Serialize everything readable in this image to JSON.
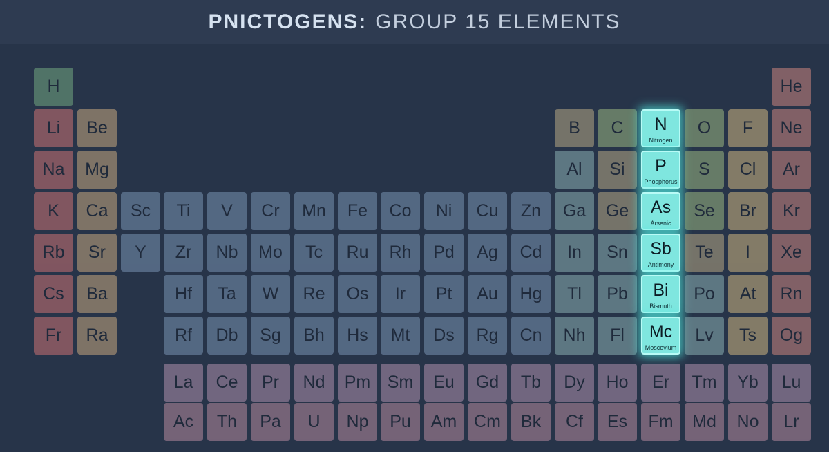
{
  "title": {
    "strong": "PNICTOGENS:",
    "light": "GROUP 15 ELEMENTS"
  },
  "colors": {
    "background": "#273449",
    "title_bar": "#2e3b51",
    "highlight": "#7fe6df",
    "highlight_glow": "#50ebe1"
  },
  "rows": [
    [
      [
        "H",
        "hydrogen"
      ],
      null,
      null,
      null,
      null,
      null,
      null,
      null,
      null,
      null,
      null,
      null,
      null,
      null,
      null,
      null,
      null,
      [
        "He",
        "noble"
      ]
    ],
    [
      [
        "Li",
        "alkali"
      ],
      [
        "Be",
        "alkaline"
      ],
      null,
      null,
      null,
      null,
      null,
      null,
      null,
      null,
      null,
      null,
      [
        "B",
        "metalloid"
      ],
      [
        "C",
        "nonmetal"
      ],
      [
        "N",
        "nonmetal",
        "Nitrogen"
      ],
      [
        "O",
        "nonmetal"
      ],
      [
        "F",
        "halogen"
      ],
      [
        "Ne",
        "noble"
      ]
    ],
    [
      [
        "Na",
        "alkali"
      ],
      [
        "Mg",
        "alkaline"
      ],
      null,
      null,
      null,
      null,
      null,
      null,
      null,
      null,
      null,
      null,
      [
        "Al",
        "post"
      ],
      [
        "Si",
        "metalloid"
      ],
      [
        "P",
        "nonmetal",
        "Phosphorus"
      ],
      [
        "S",
        "nonmetal"
      ],
      [
        "Cl",
        "halogen"
      ],
      [
        "Ar",
        "noble"
      ]
    ],
    [
      [
        "K",
        "alkali"
      ],
      [
        "Ca",
        "alkaline"
      ],
      [
        "Sc",
        "transition"
      ],
      [
        "Ti",
        "transition"
      ],
      [
        "V",
        "transition"
      ],
      [
        "Cr",
        "transition"
      ],
      [
        "Mn",
        "transition"
      ],
      [
        "Fe",
        "transition"
      ],
      [
        "Co",
        "transition"
      ],
      [
        "Ni",
        "transition"
      ],
      [
        "Cu",
        "transition"
      ],
      [
        "Zn",
        "transition"
      ],
      [
        "Ga",
        "post"
      ],
      [
        "Ge",
        "metalloid"
      ],
      [
        "As",
        "metalloid",
        "Arsenic"
      ],
      [
        "Se",
        "nonmetal"
      ],
      [
        "Br",
        "halogen"
      ],
      [
        "Kr",
        "noble"
      ]
    ],
    [
      [
        "Rb",
        "alkali"
      ],
      [
        "Sr",
        "alkaline"
      ],
      [
        "Y",
        "transition"
      ],
      [
        "Zr",
        "transition"
      ],
      [
        "Nb",
        "transition"
      ],
      [
        "Mo",
        "transition"
      ],
      [
        "Tc",
        "transition"
      ],
      [
        "Ru",
        "transition"
      ],
      [
        "Rh",
        "transition"
      ],
      [
        "Pd",
        "transition"
      ],
      [
        "Ag",
        "transition"
      ],
      [
        "Cd",
        "transition"
      ],
      [
        "In",
        "post"
      ],
      [
        "Sn",
        "post"
      ],
      [
        "Sb",
        "metalloid",
        "Antimony"
      ],
      [
        "Te",
        "metalloid"
      ],
      [
        "I",
        "halogen"
      ],
      [
        "Xe",
        "noble"
      ]
    ],
    [
      [
        "Cs",
        "alkali"
      ],
      [
        "Ba",
        "alkaline"
      ],
      null,
      [
        "Hf",
        "transition"
      ],
      [
        "Ta",
        "transition"
      ],
      [
        "W",
        "transition"
      ],
      [
        "Re",
        "transition"
      ],
      [
        "Os",
        "transition"
      ],
      [
        "Ir",
        "transition"
      ],
      [
        "Pt",
        "transition"
      ],
      [
        "Au",
        "transition"
      ],
      [
        "Hg",
        "transition"
      ],
      [
        "Tl",
        "post"
      ],
      [
        "Pb",
        "post"
      ],
      [
        "Bi",
        "post",
        "Bismuth"
      ],
      [
        "Po",
        "post"
      ],
      [
        "At",
        "halogen"
      ],
      [
        "Rn",
        "noble"
      ]
    ],
    [
      [
        "Fr",
        "alkali"
      ],
      [
        "Ra",
        "alkaline"
      ],
      null,
      [
        "Rf",
        "transition"
      ],
      [
        "Db",
        "transition"
      ],
      [
        "Sg",
        "transition"
      ],
      [
        "Bh",
        "transition"
      ],
      [
        "Hs",
        "transition"
      ],
      [
        "Mt",
        "transition"
      ],
      [
        "Ds",
        "transition"
      ],
      [
        "Rg",
        "transition"
      ],
      [
        "Cn",
        "transition"
      ],
      [
        "Nh",
        "post"
      ],
      [
        "Fl",
        "post"
      ],
      [
        "Mc",
        "post",
        "Moscovium"
      ],
      [
        "Lv",
        "post"
      ],
      [
        "Ts",
        "halogen"
      ],
      [
        "Og",
        "noble"
      ]
    ]
  ],
  "f_rows": [
    [
      [
        "La",
        "lanthanide"
      ],
      [
        "Ce",
        "lanthanide"
      ],
      [
        "Pr",
        "lanthanide"
      ],
      [
        "Nd",
        "lanthanide"
      ],
      [
        "Pm",
        "lanthanide"
      ],
      [
        "Sm",
        "lanthanide"
      ],
      [
        "Eu",
        "lanthanide"
      ],
      [
        "Gd",
        "lanthanide"
      ],
      [
        "Tb",
        "lanthanide"
      ],
      [
        "Dy",
        "lanthanide"
      ],
      [
        "Ho",
        "lanthanide"
      ],
      [
        "Er",
        "lanthanide"
      ],
      [
        "Tm",
        "lanthanide"
      ],
      [
        "Yb",
        "lanthanide"
      ],
      [
        "Lu",
        "lanthanide"
      ]
    ],
    [
      [
        "Ac",
        "actinide"
      ],
      [
        "Th",
        "actinide"
      ],
      [
        "Pa",
        "actinide"
      ],
      [
        "U",
        "actinide"
      ],
      [
        "Np",
        "actinide"
      ],
      [
        "Pu",
        "actinide"
      ],
      [
        "Am",
        "actinide"
      ],
      [
        "Cm",
        "actinide"
      ],
      [
        "Bk",
        "actinide"
      ],
      [
        "Cf",
        "actinide"
      ],
      [
        "Es",
        "actinide"
      ],
      [
        "Fm",
        "actinide"
      ],
      [
        "Md",
        "actinide"
      ],
      [
        "No",
        "actinide"
      ],
      [
        "Lr",
        "actinide"
      ]
    ]
  ]
}
